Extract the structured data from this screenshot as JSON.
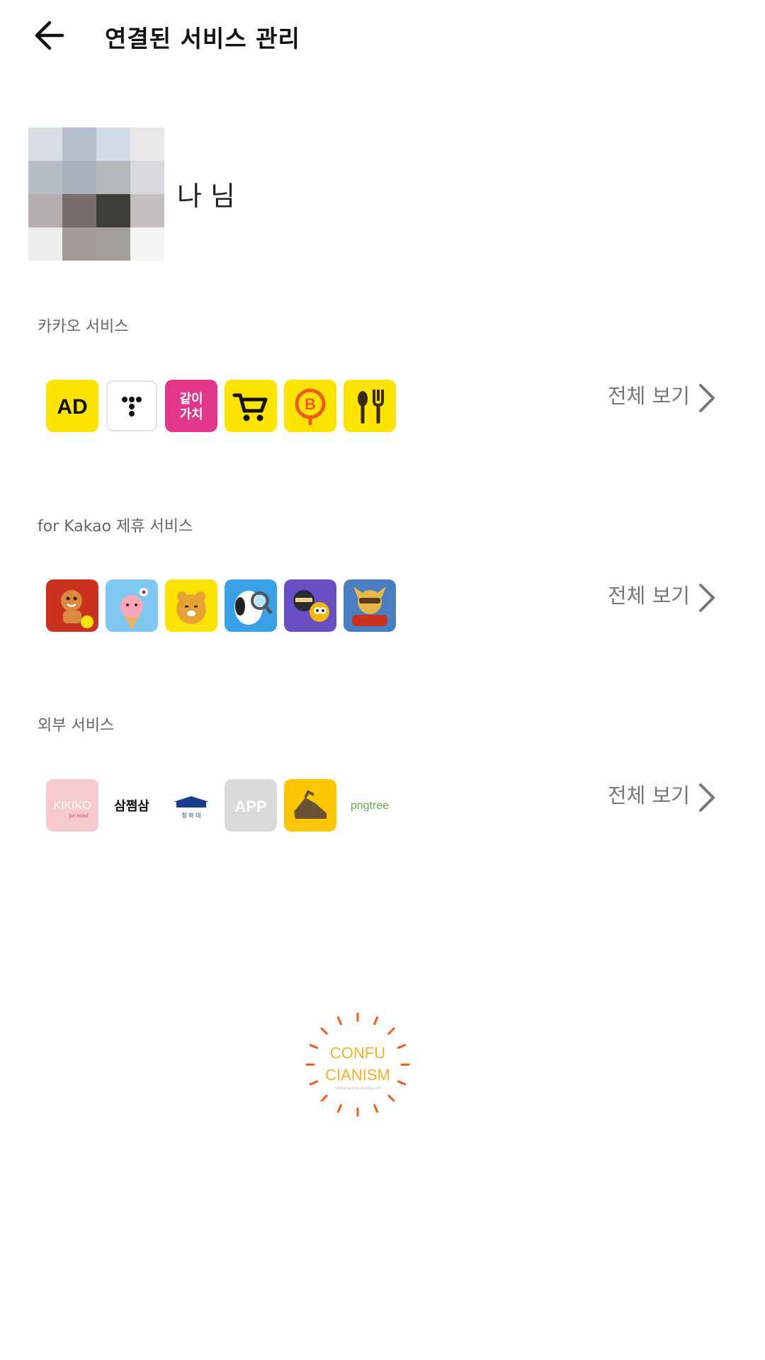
{
  "header": {
    "title": "연결된 서비스 관리",
    "back_icon": "arrow-left-icon"
  },
  "profile": {
    "name": "나 님",
    "avatar_colors": [
      "#d8dce3",
      "#b6bfcd",
      "#d2dbe8",
      "#e8e8e8",
      "#b6bcc6",
      "#aab1bc",
      "#b3b7b9",
      "#d8dae0",
      "#b4afae",
      "#766d6a",
      "#3f3f3a",
      "#c5c0bf",
      "#ececeb",
      "#a49b98",
      "#a09d9b",
      "#f4f4f2"
    ]
  },
  "sections": [
    {
      "label": "카카오 서비스",
      "view_all": "전체 보기",
      "icons": [
        {
          "name": "kakao-ad-icon",
          "text": "AD"
        },
        {
          "name": "kakao-t-icon",
          "text": ""
        },
        {
          "name": "together-value-icon",
          "text": "같이\n가치"
        },
        {
          "name": "shopping-cart-icon",
          "text": ""
        },
        {
          "name": "kakao-bank-b-icon",
          "text": "B"
        },
        {
          "name": "food-spoon-fork-icon",
          "text": ""
        }
      ]
    },
    {
      "label": "for Kakao 제휴 서비스",
      "view_all": "전체 보기",
      "icons": [
        {
          "name": "cookie-run-game-icon"
        },
        {
          "name": "apeach-game-icon"
        },
        {
          "name": "ryan-game-icon"
        },
        {
          "name": "snoopy-game-icon"
        },
        {
          "name": "ninja-game-icon"
        },
        {
          "name": "racing-game-icon"
        }
      ]
    },
    {
      "label": "외부 서비스",
      "view_all": "전체 보기",
      "icons": [
        {
          "name": "kikiko-icon",
          "text": "KIKIKO"
        },
        {
          "name": "samjjamsam-icon",
          "text": "삼쩜삼"
        },
        {
          "name": "cheongwadae-icon",
          "text": "청 와 대"
        },
        {
          "name": "generic-app-icon",
          "text": "APP"
        },
        {
          "name": "running-shoe-icon",
          "text": ""
        },
        {
          "name": "pngtree-icon",
          "text": "pngtree"
        }
      ]
    }
  ],
  "watermark": {
    "line1": "CONFU",
    "line2": "CIANISM",
    "line3": "confucianism.tistory.com"
  },
  "colors": {
    "kakao_yellow": "#fce300",
    "pink": "#e3358a",
    "orange": "#ef5a1e"
  }
}
